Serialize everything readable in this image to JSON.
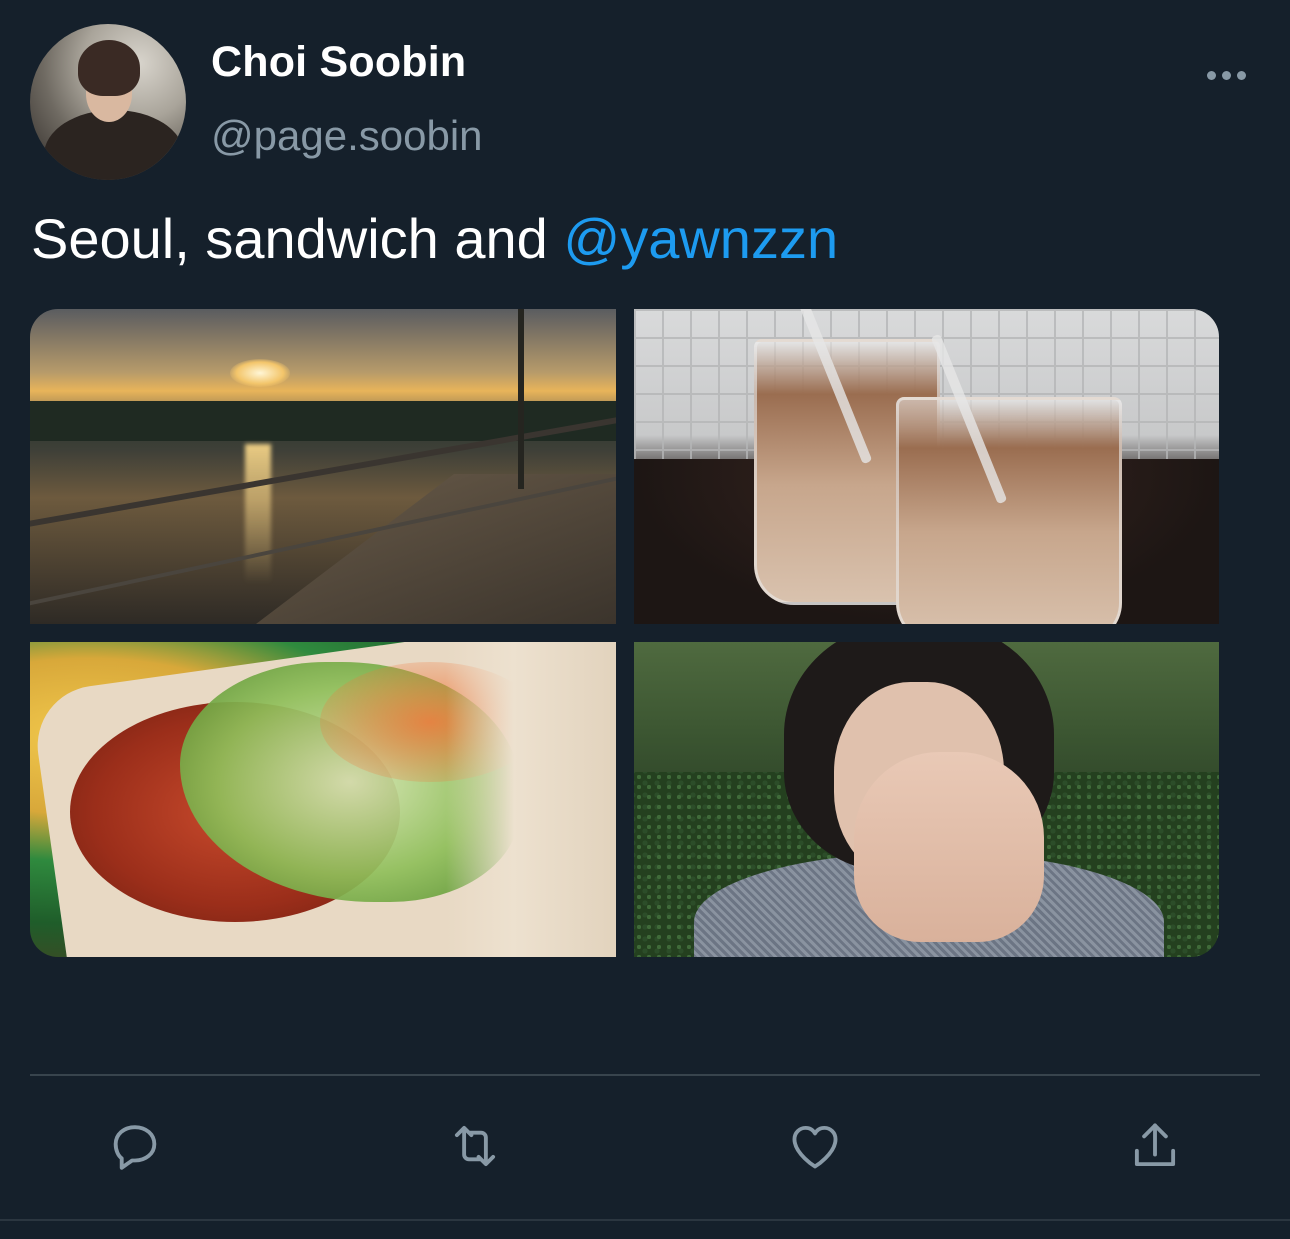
{
  "tweet": {
    "author": {
      "name": "Choi Soobin",
      "handle": "@page.soobin"
    },
    "text": "Seoul, sandwich and ",
    "mention": "@yawnzzn",
    "media": [
      {
        "subject": "riverside boardwalk at sunset"
      },
      {
        "subject": "two iced lattes in cups"
      },
      {
        "subject": "sandwich close-up"
      },
      {
        "subject": "person covering face with hands"
      }
    ],
    "actions": [
      {
        "icon": "reply-icon"
      },
      {
        "icon": "retweet-icon"
      },
      {
        "icon": "like-icon"
      },
      {
        "icon": "share-icon"
      }
    ]
  },
  "colors": {
    "background": "#15202b",
    "secondary_text": "#8899a6",
    "mention": "#1d9bf0",
    "divider": "#38444d"
  }
}
